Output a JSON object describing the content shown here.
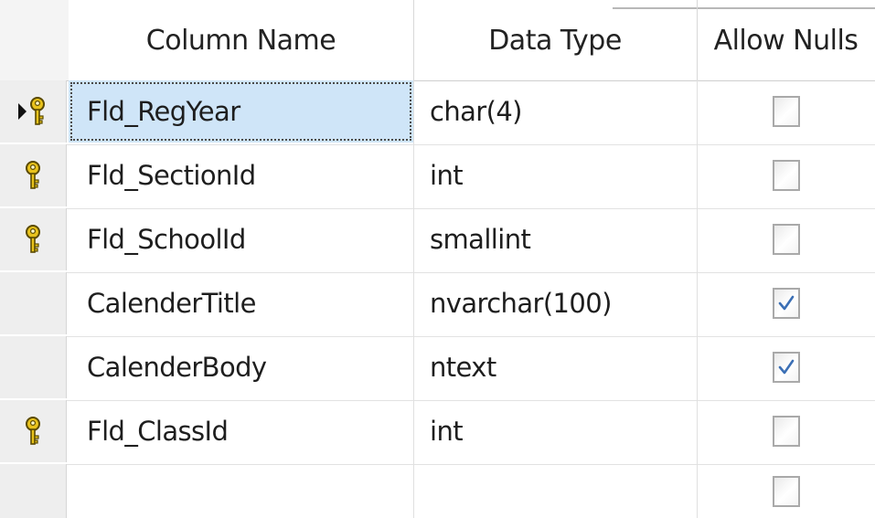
{
  "header": {
    "column_name": "Column Name",
    "data_type": "Data Type",
    "allow_nulls": "Allow Nulls"
  },
  "icons": {
    "primary_key": "key-icon",
    "current_row": "row-pointer-arrow-icon",
    "checkbox": "checkbox-icon"
  },
  "colors": {
    "selection_fill": "#cfe5f8",
    "key_gold": "#e8c21c",
    "check_blue": "#3b6fb5"
  },
  "rows": [
    {
      "name": "Fld_RegYear",
      "type": "char(4)",
      "allow_nulls": false,
      "primary_key": true,
      "current": true
    },
    {
      "name": "Fld_SectionId",
      "type": "int",
      "allow_nulls": false,
      "primary_key": true,
      "current": false
    },
    {
      "name": "Fld_SchoolId",
      "type": "smallint",
      "allow_nulls": false,
      "primary_key": true,
      "current": false
    },
    {
      "name": "CalenderTitle",
      "type": "nvarchar(100)",
      "allow_nulls": true,
      "primary_key": false,
      "current": false
    },
    {
      "name": "CalenderBody",
      "type": "ntext",
      "allow_nulls": true,
      "primary_key": false,
      "current": false
    },
    {
      "name": "Fld_ClassId",
      "type": "int",
      "allow_nulls": false,
      "primary_key": true,
      "current": false
    },
    {
      "name": "",
      "type": "",
      "allow_nulls": false,
      "primary_key": false,
      "current": false
    }
  ]
}
